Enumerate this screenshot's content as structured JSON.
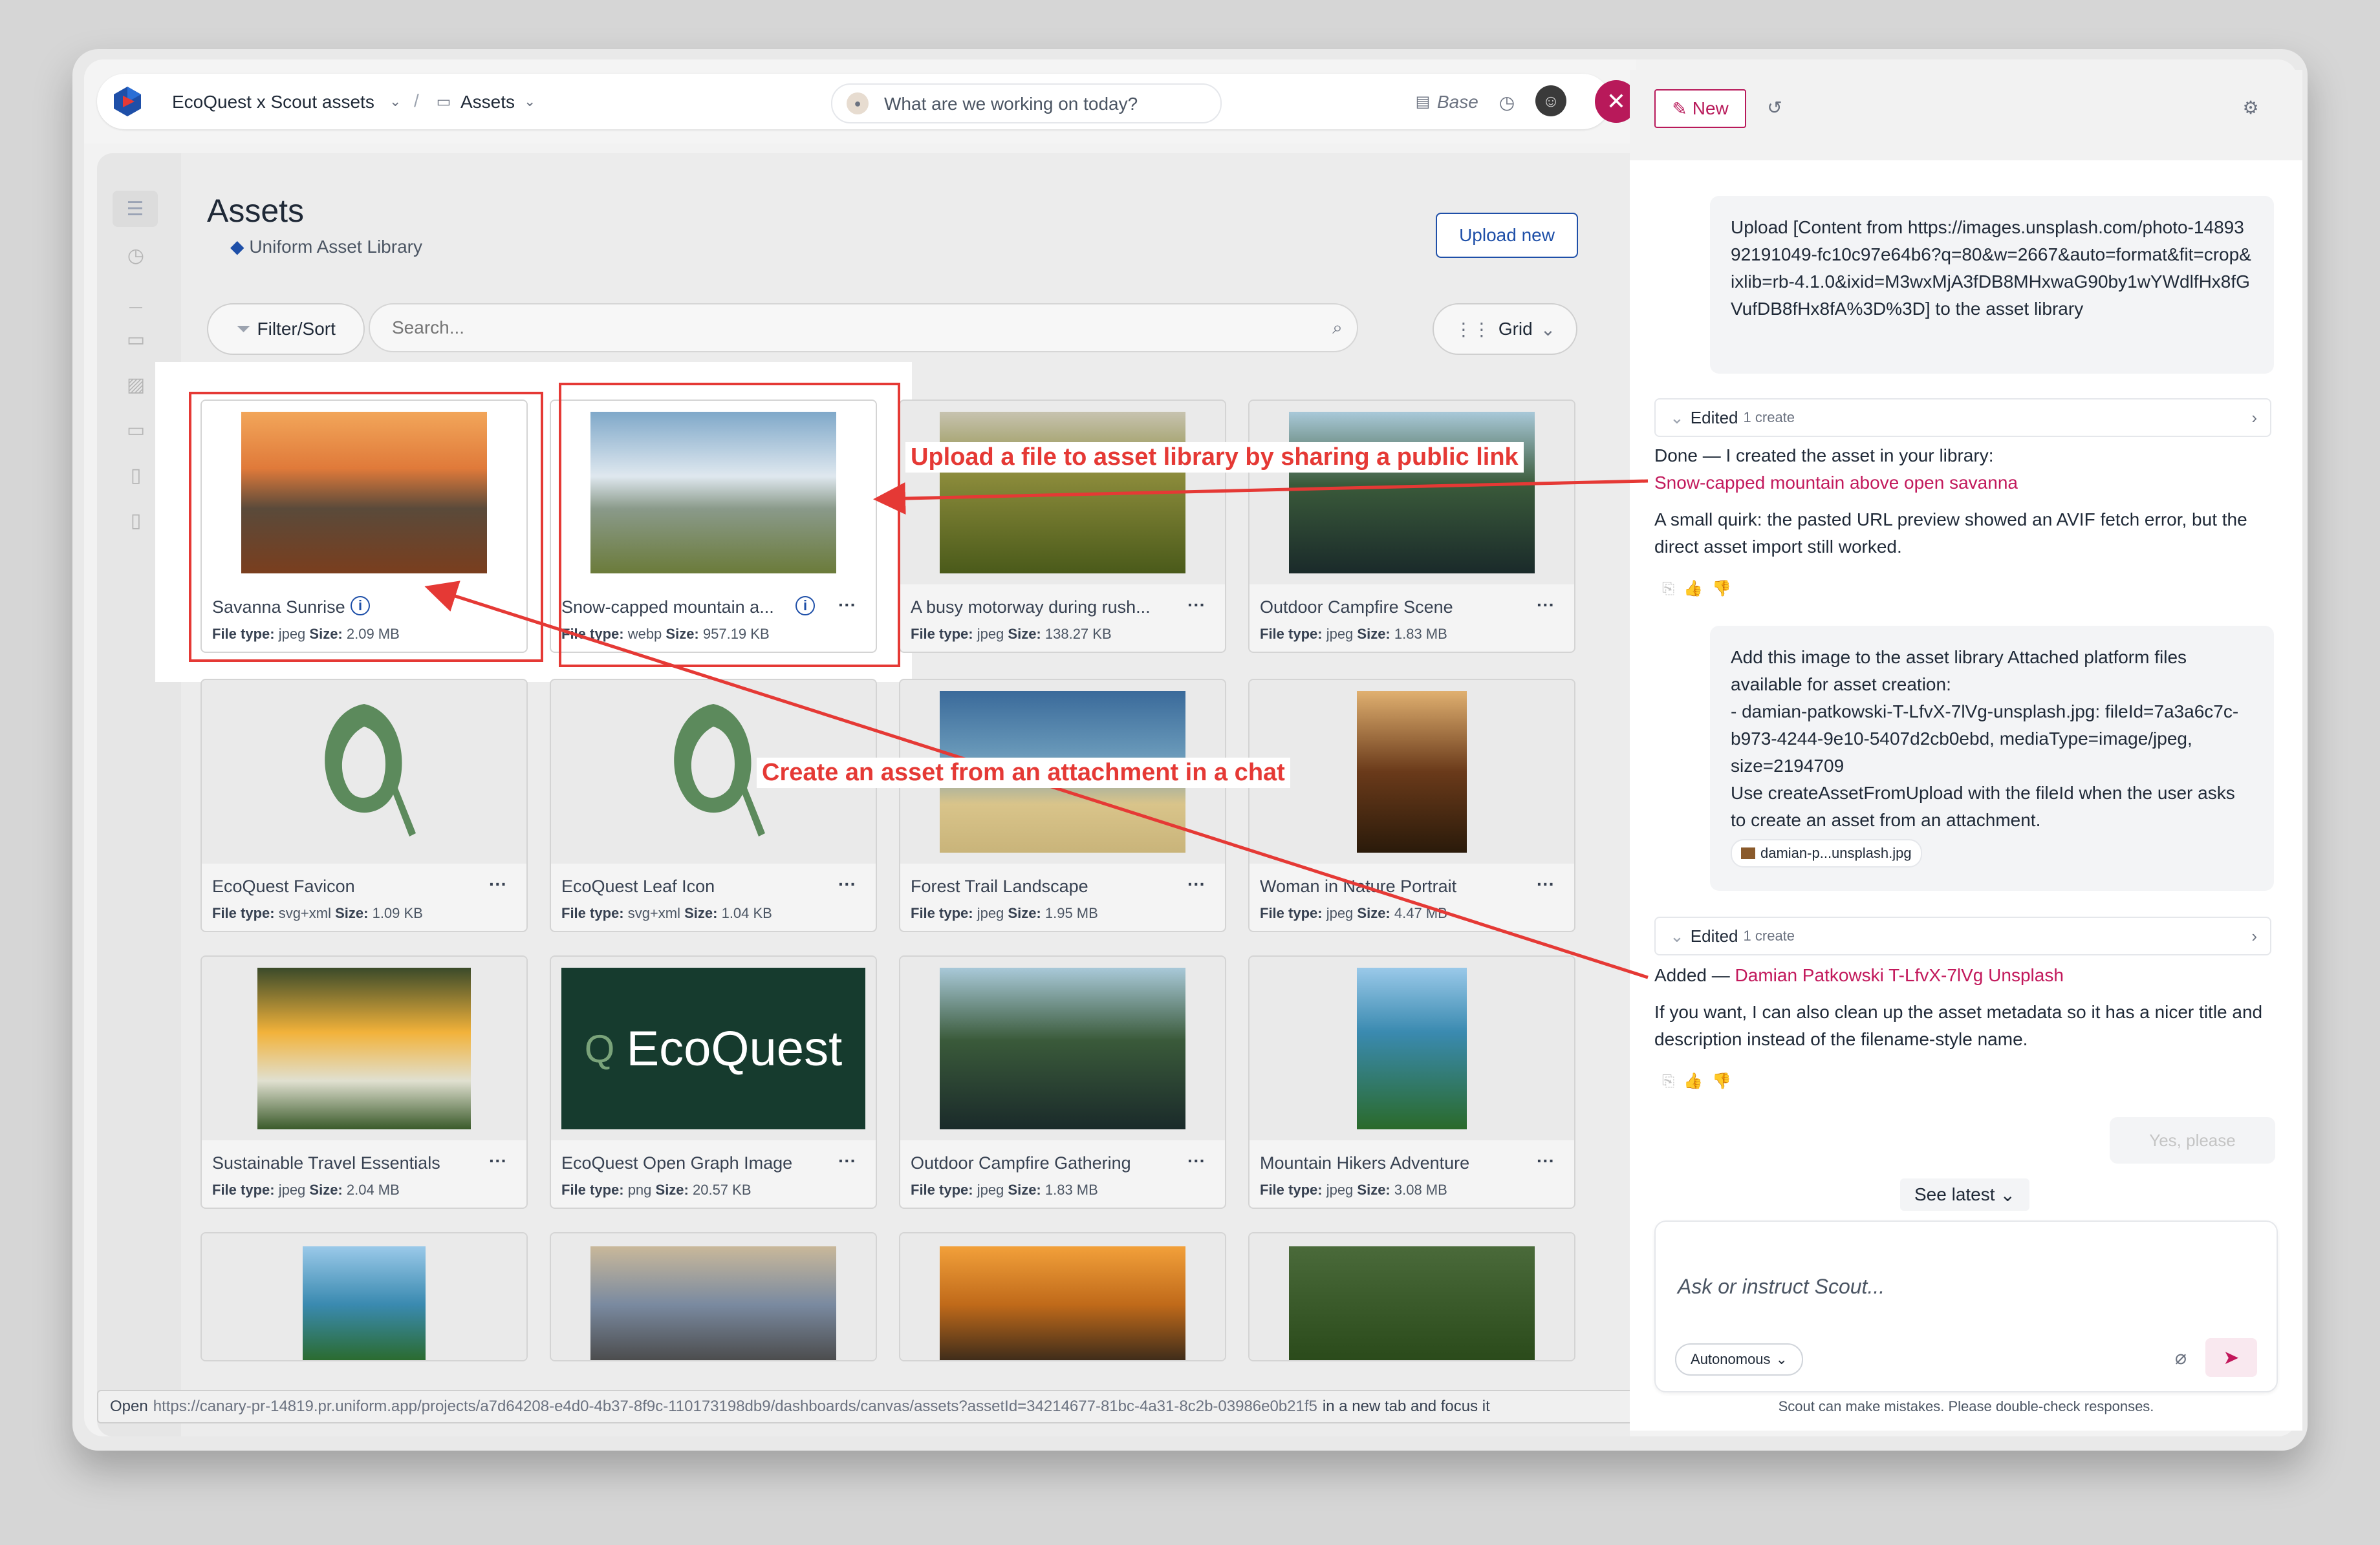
{
  "app": {
    "project": "EcoQuest x Scout assets",
    "section": "Assets",
    "prompt_placeholder": "What are we working on today?",
    "base_label": "Base"
  },
  "assets_page": {
    "title": "Assets",
    "subtitle": "Uniform Asset Library",
    "upload_label": "Upload new",
    "filter_label": "Filter/Sort",
    "search_placeholder": "Search...",
    "view_label": "Grid",
    "file_type_label": "File type:",
    "size_label": "Size:",
    "assets": [
      {
        "name": "Savanna Sunrise",
        "type": "jpeg",
        "size": "2.09 MB",
        "thumb": "savanna"
      },
      {
        "name": "Snow-capped mountain a...",
        "type": "webp",
        "size": "957.19 KB",
        "thumb": "mountain"
      },
      {
        "name": "A busy motorway during rush...",
        "type": "jpeg",
        "size": "138.27 KB",
        "thumb": "terraces"
      },
      {
        "name": "Outdoor Campfire Scene",
        "type": "jpeg",
        "size": "1.83 MB",
        "thumb": "cliffs"
      },
      {
        "name": "EcoQuest Favicon",
        "type": "svg+xml",
        "size": "1.09 KB",
        "thumb": "leaf"
      },
      {
        "name": "EcoQuest Leaf Icon",
        "type": "svg+xml",
        "size": "1.04 KB",
        "thumb": "leaf"
      },
      {
        "name": "Forest Trail Landscape",
        "type": "jpeg",
        "size": "1.95 MB",
        "thumb": "beach"
      },
      {
        "name": "Woman in Nature Portrait",
        "type": "jpeg",
        "size": "4.47 MB",
        "thumb": "street"
      },
      {
        "name": "Sustainable Travel Essentials",
        "type": "jpeg",
        "size": "2.04 MB",
        "thumb": "food"
      },
      {
        "name": "EcoQuest Open Graph Image",
        "type": "png",
        "size": "20.57 KB",
        "thumb": "og"
      },
      {
        "name": "Outdoor Campfire Gathering",
        "type": "jpeg",
        "size": "1.83 MB",
        "thumb": "cliffs"
      },
      {
        "name": "Mountain Hikers Adventure",
        "type": "jpeg",
        "size": "3.08 MB",
        "thumb": "bay"
      }
    ],
    "og_text": "EcoQuest"
  },
  "annotations": {
    "upload_link": "Upload a file to asset library by sharing a public link",
    "attachment": "Create an asset from an attachment in a chat"
  },
  "status_bar": {
    "prefix": "Open",
    "url": "https://canary-pr-14819.pr.uniform.app/projects/a7d64208-e4d0-4b37-8f9c-110173198db9/dashboards/canvas/assets?assetId=34214677-81bc-4a31-8c2b-03986e0b21f5",
    "suffix": "in a new tab and focus it"
  },
  "chat": {
    "new_label": "New",
    "user_msg_1": "Upload  [Content from https://images.unsplash.com/photo-1489392191049-fc10c97e64b6?q=80&w=2667&auto=format&fit=crop&ixlib=rb-4.1.0&ixid=M3wxMjA3fDB8MHxwaG90by1wYWdlfHx8fGVufDB8fHx8fA%3D%3D] to the asset library",
    "edited_label": "Edited",
    "edited_count": "1 create",
    "reply_1_intro": "Done — I created the asset in your library:",
    "reply_1_link": "Snow-capped mountain above open savanna",
    "reply_1_note": "A small quirk: the pasted URL preview showed an AVIF fetch error, but the direct asset import still worked.",
    "user_msg_2_lines": [
      "Add this image to the asset library Attached platform files available for asset creation:",
      "- damian-patkowski-T-LfvX-7lVg-unsplash.jpg: fileId=7a3a6c7c-b973-4244-9e10-5407d2cb0ebd, mediaType=image/jpeg, size=2194709",
      "Use createAssetFromUpload with the fileId when the user asks to create an asset from an attachment."
    ],
    "attachment_chip": "damian-p...unsplash.jpg",
    "reply_2_prefix": "Added —",
    "reply_2_link": "Damian Patkowski T-LfvX-7lVg Unsplash",
    "reply_2_note": "If you want, I can also clean up the asset metadata so it has a nicer title and description instead of the filename-style name.",
    "yes_please": "Yes, please",
    "see_latest": "See latest",
    "composer_placeholder": "Ask or instruct Scout...",
    "mode": "Autonomous",
    "disclaimer": "Scout can make mistakes. Please double-check responses."
  }
}
